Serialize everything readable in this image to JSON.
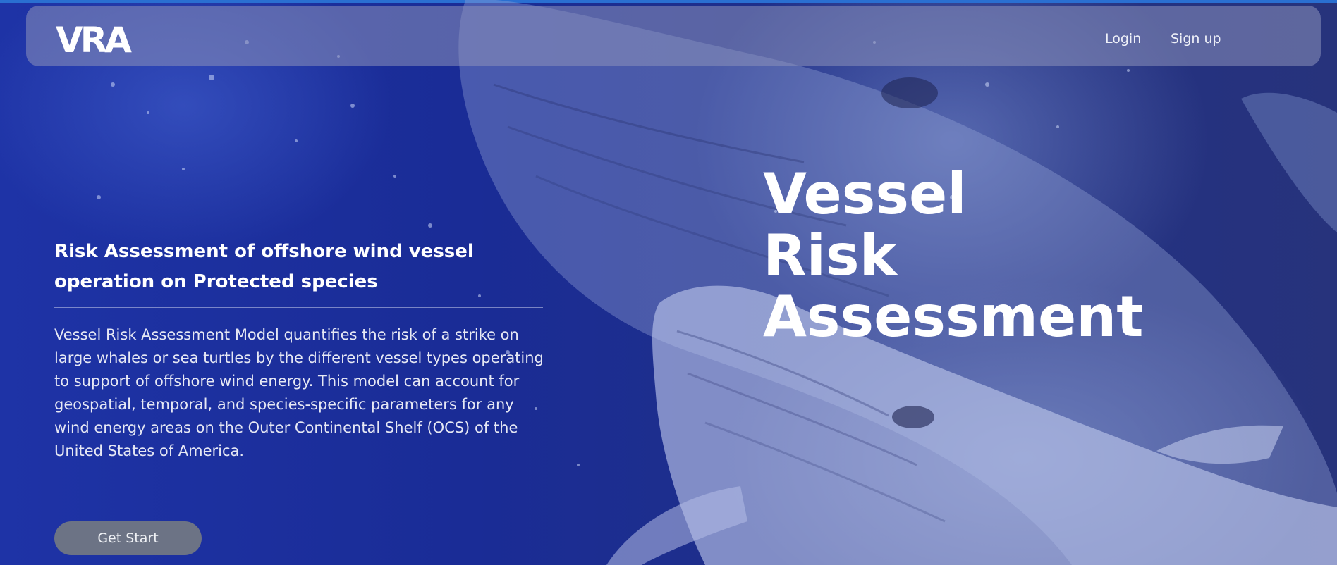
{
  "nav": {
    "logo_text": "VRA",
    "login_label": "Login",
    "signup_label": "Sign up"
  },
  "hero": {
    "subtitle": "Risk Assessment of offshore wind vessel operation on Protected species",
    "description": "Vessel Risk Assessment Model quantifies the risk of a strike on large whales or sea turtles by the different vessel types operating to support of offshore wind energy. This model can account for geospatial, temporal, and species-specific parameters for any wind energy areas on the Outer Continental Shelf (OCS) of the United States of America.",
    "cta_label": "Get Start",
    "title_lines": [
      "Vessel",
      "Risk",
      "Assessment"
    ]
  },
  "colors": {
    "background": "#1a2a8c",
    "navbar": "#8c91b9",
    "button": "#6c7385",
    "text": "#ffffff"
  }
}
